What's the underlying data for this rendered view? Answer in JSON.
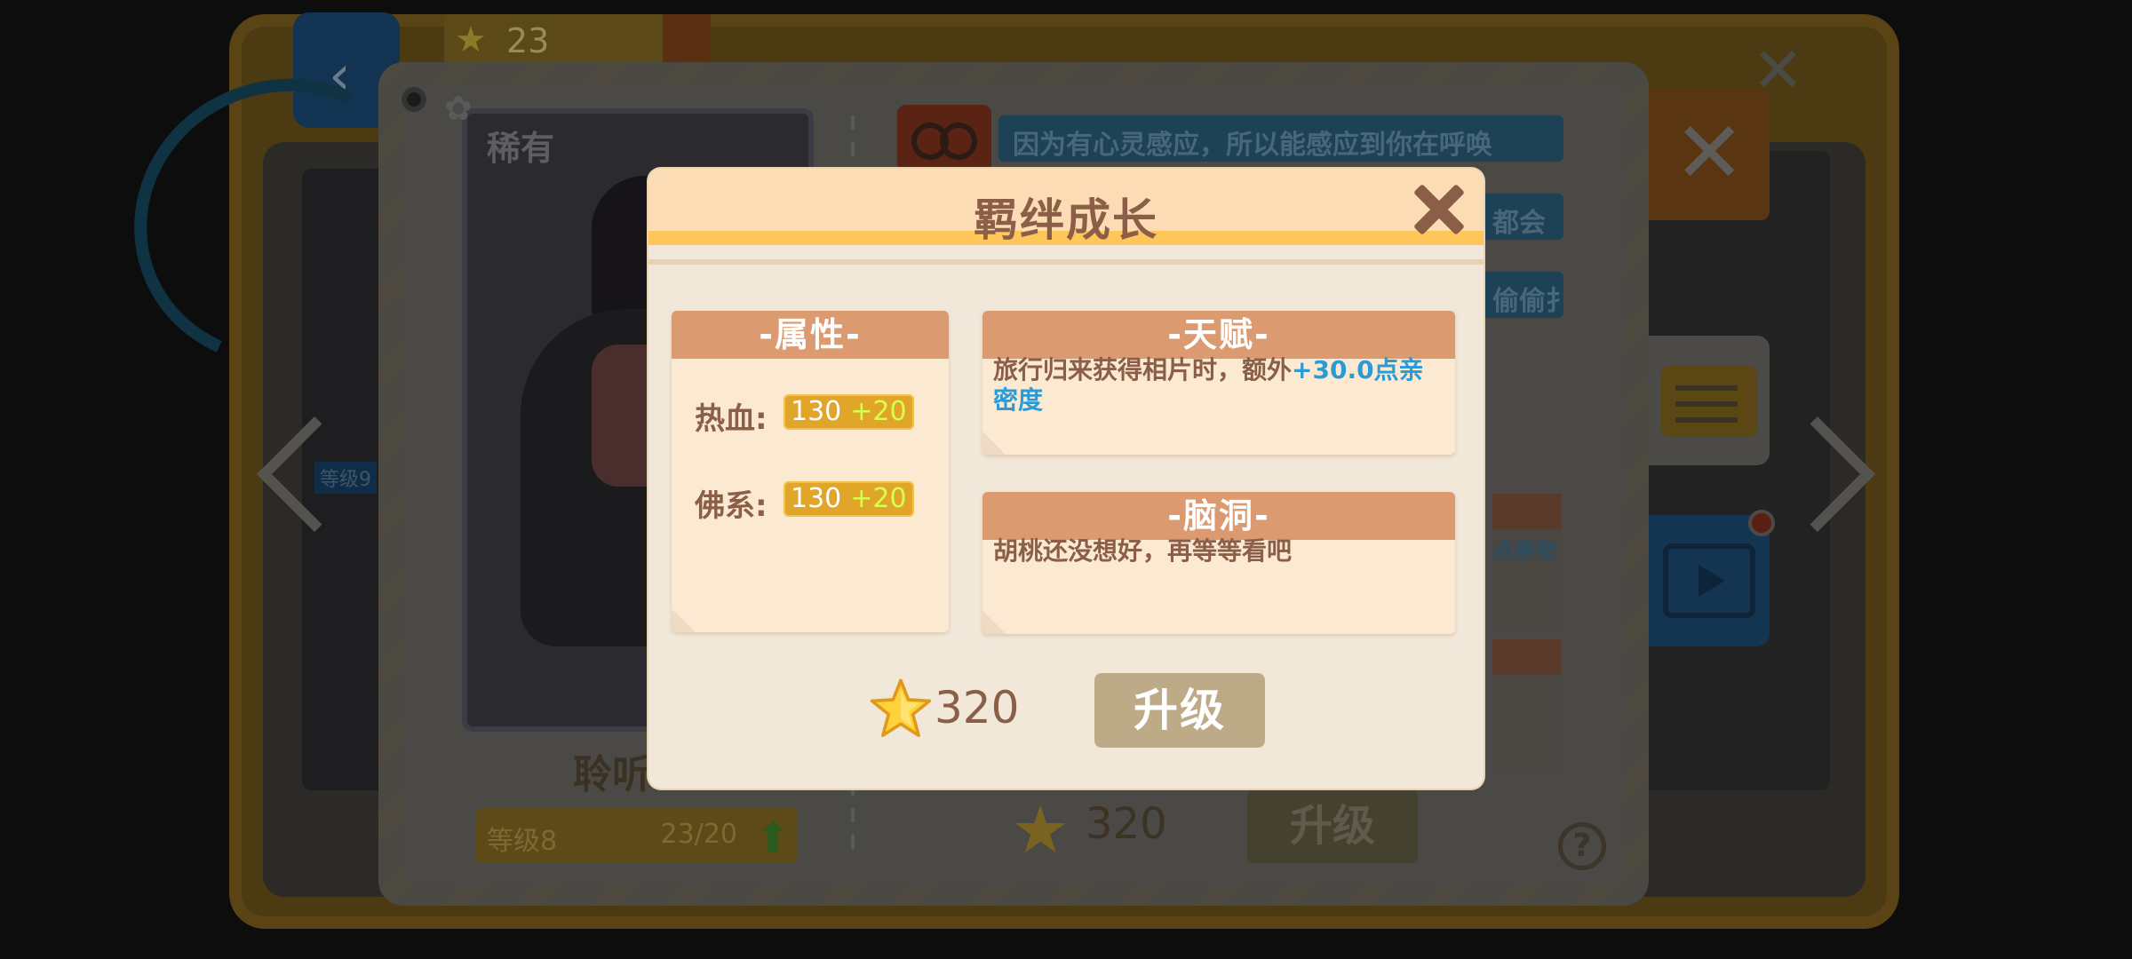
{
  "background": {
    "currency_value": "23",
    "rarity_label": "稀有",
    "character_name": "聆听",
    "level_label": "等级8",
    "level_progress": "23/20",
    "left_strip_level": "等级9",
    "story_lines": [
      "因为有心灵感应，所以能感应到你在呼唤",
      "都会",
      "偷偷扌"
    ],
    "side_note": "点亲密",
    "cost_value": "320",
    "upgrade_label": "升级",
    "help_symbol": "?"
  },
  "modal": {
    "title": "羁绊成长",
    "attributes": {
      "header": "-属性-",
      "items": [
        {
          "label": "热血:",
          "value": "130",
          "bonus": "+20"
        },
        {
          "label": "佛系:",
          "value": "130",
          "bonus": "+20"
        }
      ]
    },
    "talent": {
      "header": "-天赋-",
      "text_before": "旅行归来获得相片时，额外",
      "highlight": "+30.0点亲密度"
    },
    "brain": {
      "header": "-脑洞-",
      "text": "胡桃还没想好，再等等看吧"
    },
    "cost": "320",
    "upgrade_label": "升级"
  },
  "colors": {
    "accent_orange": "#dc9a70",
    "title_brown": "#8b5e48",
    "highlight_blue": "#2a9bd6",
    "pill_gold": "#e1a52a",
    "bonus_green": "#d6ff4a",
    "header_stripe": "#ffc75a"
  },
  "icons": {
    "star": "star-icon",
    "close": "close-icon",
    "help": "help-icon",
    "video": "video-icon",
    "notes": "notes-icon"
  }
}
